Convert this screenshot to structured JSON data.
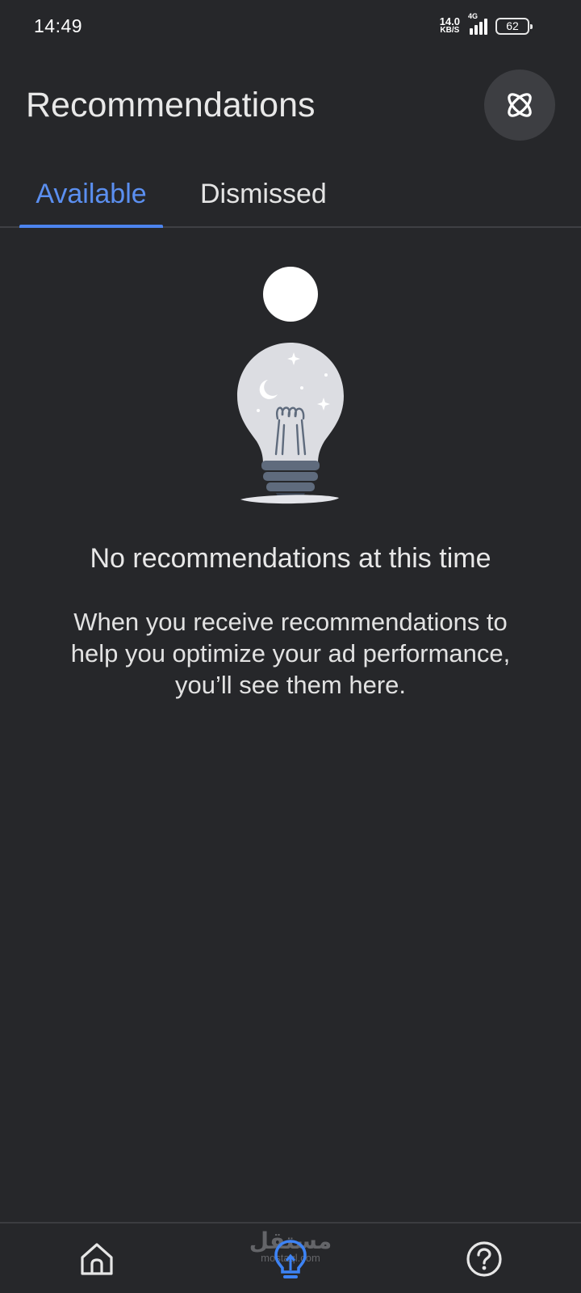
{
  "status_bar": {
    "time": "14:49",
    "net_speed_value": "14.0",
    "net_speed_unit": "KB/S",
    "network_type": "4G",
    "battery": "62"
  },
  "header": {
    "title": "Recommendations",
    "labs_icon": "atom-icon"
  },
  "tabs": [
    {
      "label": "Available",
      "selected": true
    },
    {
      "label": "Dismissed",
      "selected": false
    }
  ],
  "empty_state": {
    "title": "No recommendations at this time",
    "description": "When you receive recommendations to help you optimize your ad performance, you’ll see them here."
  },
  "bottom_nav": {
    "items": [
      {
        "icon": "home-icon"
      },
      {
        "icon": "lightbulb-icon",
        "active": true
      },
      {
        "icon": "help-icon"
      }
    ],
    "watermark_ar": "مستقل",
    "watermark_en": "mostaql.com"
  },
  "colors": {
    "background": "#26272a",
    "accent": "#4c84ee"
  }
}
